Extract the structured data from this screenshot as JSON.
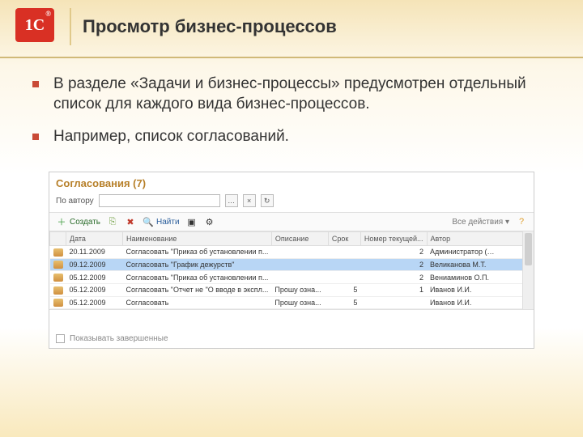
{
  "header": {
    "title": "Просмотр бизнес-процессов",
    "logo_text": "1С"
  },
  "bullets": [
    "В разделе «Задачи и бизнес-процессы» предусмотрен отдельный список для каждого вида бизнес-процессов.",
    "Например, список согласований."
  ],
  "screenshot": {
    "title": "Согласования (7)",
    "filter_label": "По автору",
    "toolbar": {
      "create": "Создать",
      "find": "Найти",
      "all_actions": "Все действия ▾"
    },
    "columns": [
      "",
      "Дата",
      "Наименование",
      "Описание",
      "Срок",
      "Номер текущей...",
      "Автор"
    ],
    "rows": [
      {
        "date": "20.11.2009",
        "name": "Согласовать \"Приказ об установлении п...",
        "desc": "",
        "due": "",
        "num": "2",
        "author": "Администратор (…"
      },
      {
        "date": "09.12.2009",
        "name": "Согласовать \"График дежурств\"",
        "desc": "",
        "due": "",
        "num": "2",
        "author": "Великанова М.Т."
      },
      {
        "date": "05.12.2009",
        "name": "Согласовать \"Приказ об установлении п...",
        "desc": "",
        "due": "",
        "num": "2",
        "author": "Вениаминов О.П."
      },
      {
        "date": "05.12.2009",
        "name": "Согласовать \"Отчет не \"О вводе в экспл...",
        "desc": "Прошу озна...",
        "due": "5",
        "num": "1",
        "author": "Иванов И.И."
      },
      {
        "date": "05.12.2009",
        "name": "Согласовать",
        "desc": "Прошу озна...",
        "due": "5",
        "num": "",
        "author": "Иванов И.И."
      }
    ],
    "footer_label": "Показывать завершенные"
  }
}
